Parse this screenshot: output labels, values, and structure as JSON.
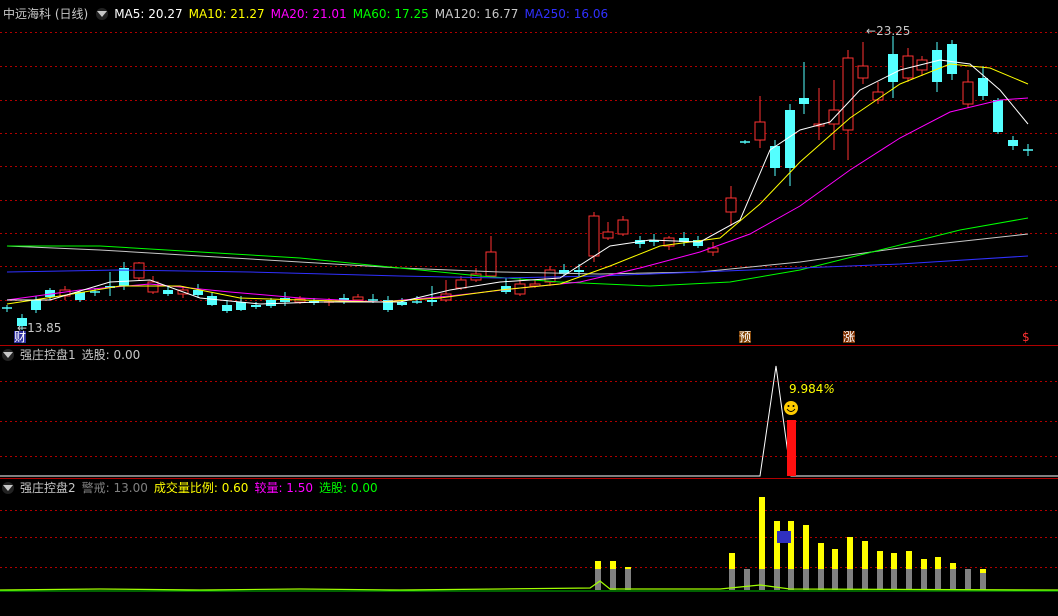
{
  "main": {
    "title": "中远海科 (日线)",
    "ma": [
      {
        "label": "MA5: 20.27",
        "color": "#ffffff"
      },
      {
        "label": "MA10: 21.27",
        "color": "#ffff00"
      },
      {
        "label": "MA20: 21.01",
        "color": "#ff00ff"
      },
      {
        "label": "MA60: 17.25",
        "color": "#00ff00"
      },
      {
        "label": "MA120: 16.77",
        "color": "#c8c8c8"
      },
      {
        "label": "MA250: 16.06",
        "color": "#3030ff"
      }
    ],
    "high_label": "23.25",
    "low_label": "13.85",
    "markers": {
      "cai": "财",
      "yu": "预",
      "zhang": "涨",
      "s": "$"
    }
  },
  "panel1": {
    "title": "强庄控盘1",
    "xuangu": "选股: 0.00",
    "pct_label": "9.984",
    "pct_sign": "%"
  },
  "panel2": {
    "title": "强庄控盘2",
    "jingjie": "警戒: 13.00",
    "ratio": "成交量比例: 0.60",
    "jiaoliang": "较量: 1.50",
    "xuangu": "选股: 0.00"
  },
  "colors": {
    "up": "#ff3232",
    "down": "#54ffff",
    "grid": "#b00000"
  }
}
